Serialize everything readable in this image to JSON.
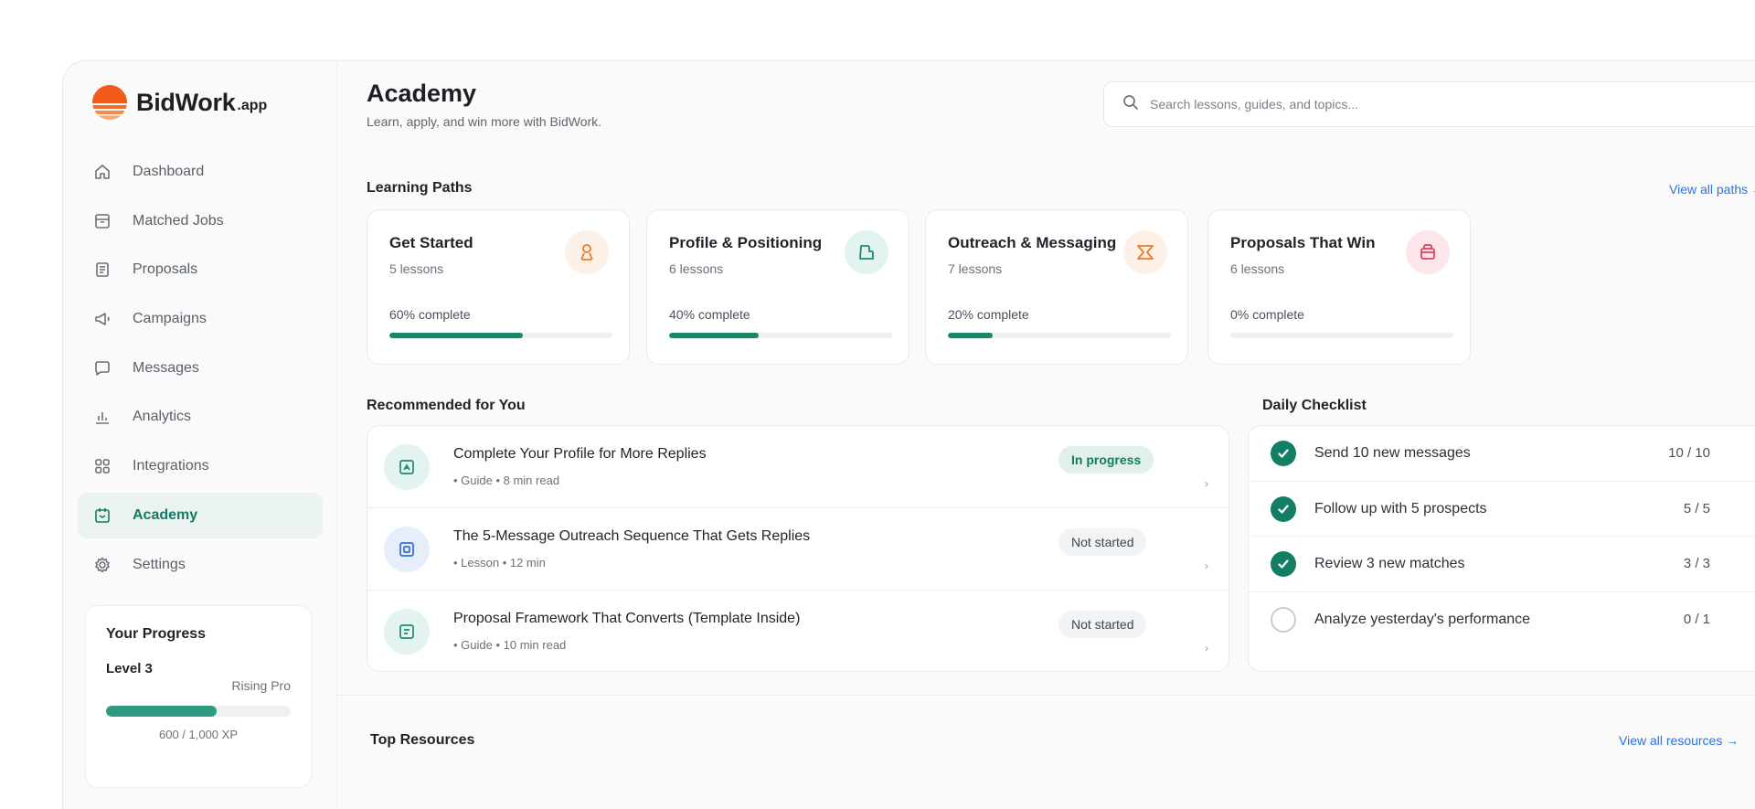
{
  "brand": {
    "name": "BidWork",
    "tld": ".app",
    "logo_color": "#f25a1c"
  },
  "nav": {
    "items": [
      {
        "label": "Dashboard",
        "icon": "home-icon"
      },
      {
        "label": "Matched Jobs",
        "icon": "briefcase-icon"
      },
      {
        "label": "Proposals",
        "icon": "document-icon"
      },
      {
        "label": "Campaigns",
        "icon": "megaphone-icon"
      },
      {
        "label": "Messages",
        "icon": "chat-icon"
      },
      {
        "label": "Analytics",
        "icon": "bar-chart-icon"
      },
      {
        "label": "Integrations",
        "icon": "grid-icon"
      },
      {
        "label": "Academy",
        "icon": "academy-icon",
        "active": true
      },
      {
        "label": "Settings",
        "icon": "gear-icon"
      }
    ]
  },
  "progress": {
    "title": "Your Progress",
    "level": "Level 3",
    "rank": "Rising Pro",
    "xp_text": "600 / 1,000 XP",
    "fraction": 0.6
  },
  "header": {
    "title": "Academy",
    "subtitle": "Learn, apply, and win more with BidWork.",
    "search_placeholder": "Search lessons, guides, and topics..."
  },
  "learning_paths": {
    "title": "Learning Paths",
    "view_all": "View all paths →",
    "items": [
      {
        "name": "Get Started",
        "lessons": "5 lessons",
        "complete_text": "60% complete",
        "percent": 60,
        "icon": "person-icon",
        "badge_color": "#fdf0e6",
        "icon_color": "#f07a2a"
      },
      {
        "name": "Profile & Positioning",
        "lessons": "6 lessons",
        "complete_text": "40% complete",
        "percent": 40,
        "icon": "profile-card-icon",
        "badge_color": "#e3f3ef",
        "icon_color": "#1e8a6f"
      },
      {
        "name": "Outreach & Messaging",
        "lessons": "7 lessons",
        "complete_text": "20% complete",
        "percent": 20,
        "icon": "send-icon",
        "badge_color": "#fdf0e6",
        "icon_color": "#f07a2a"
      },
      {
        "name": "Proposals That Win",
        "lessons": "6 lessons",
        "complete_text": "0% complete",
        "percent": 0,
        "icon": "trophy-icon",
        "badge_color": "#fde6ea",
        "icon_color": "#e0425c"
      }
    ]
  },
  "recommended": {
    "title": "Recommended for You",
    "items": [
      {
        "title": "Complete Your Profile for More Replies",
        "meta": "• Guide • 8 min read",
        "status": "In progress",
        "status_type": "inprog",
        "icon": "guide-icon",
        "icon_bg": "#e3f3ef",
        "icon_color": "#1e8a6f"
      },
      {
        "title": "The 5-Message Outreach Sequence That Gets Replies",
        "meta": "• Lesson • 12 min",
        "status": "Not started",
        "status_type": "notstarted",
        "icon": "lesson-icon",
        "icon_bg": "#e6eefc",
        "icon_color": "#2f6fe0"
      },
      {
        "title": "Proposal Framework That Converts (Template Inside)",
        "meta": "• Guide • 10 min read",
        "status": "Not started",
        "status_type": "notstarted",
        "icon": "template-icon",
        "icon_bg": "#e3f3ef",
        "icon_color": "#1e8a6f"
      }
    ]
  },
  "checklist": {
    "title": "Daily Checklist",
    "items": [
      {
        "label": "Send 10 new messages",
        "count": "10 / 10",
        "done": true
      },
      {
        "label": "Follow up with 5 prospects",
        "count": "5 / 5",
        "done": true
      },
      {
        "label": "Review 3 new matches",
        "count": "3 / 3",
        "done": true
      },
      {
        "label": "Analyze yesterday's performance",
        "count": "0 / 1",
        "done": false
      }
    ]
  },
  "resources": {
    "title": "Top Resources",
    "view_all": "View all resources →"
  },
  "colors": {
    "accent": "#157a62",
    "link": "#2b73e0"
  }
}
